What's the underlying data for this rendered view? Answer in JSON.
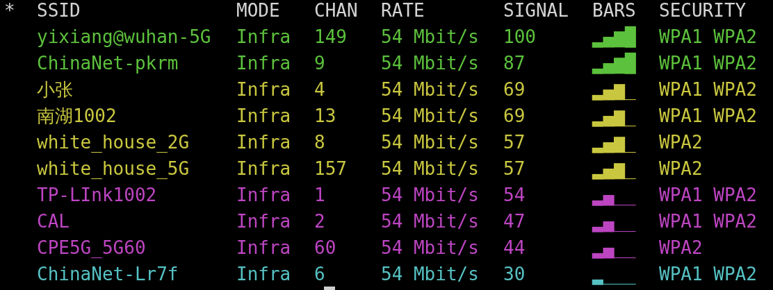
{
  "header": [
    "*",
    "SSID",
    "MODE",
    "CHAN",
    "RATE",
    "SIGNAL",
    "BARS",
    "SECURITY"
  ],
  "rows": [
    {
      "ssid": "yixiang@wuhan-5G",
      "mode": "Infra",
      "chan": "149",
      "rate": "54 Mbit/s",
      "signal": "100",
      "bars": "▂▄▆█",
      "security": "WPA1 WPA2",
      "color": "#5cc13c"
    },
    {
      "ssid": "ChinaNet-pkrm",
      "mode": "Infra",
      "chan": "9",
      "rate": "54 Mbit/s",
      "signal": "87",
      "bars": "▂▄▆█",
      "security": "WPA1 WPA2",
      "color": "#5cc13c"
    },
    {
      "ssid": "小张",
      "mode": "Infra",
      "chan": "4",
      "rate": "54 Mbit/s",
      "signal": "69",
      "bars": "▂▄▆_",
      "security": "WPA1 WPA2",
      "color": "#c9c73f"
    },
    {
      "ssid": "南湖1002",
      "mode": "Infra",
      "chan": "13",
      "rate": "54 Mbit/s",
      "signal": "69",
      "bars": "▂▄▆_",
      "security": "WPA1 WPA2",
      "color": "#c9c73f"
    },
    {
      "ssid": "white_house_2G",
      "mode": "Infra",
      "chan": "8",
      "rate": "54 Mbit/s",
      "signal": "57",
      "bars": "▂▄▆_",
      "security": "WPA2",
      "color": "#c9c73f"
    },
    {
      "ssid": "white_house_5G",
      "mode": "Infra",
      "chan": "157",
      "rate": "54 Mbit/s",
      "signal": "57",
      "bars": "▂▄▆_",
      "security": "WPA2",
      "color": "#c9c73f"
    },
    {
      "ssid": "TP-LInk1002",
      "mode": "Infra",
      "chan": "1",
      "rate": "54 Mbit/s",
      "signal": "54",
      "bars": "▂▄__",
      "security": "WPA1 WPA2",
      "color": "#bd45c2"
    },
    {
      "ssid": "CAL",
      "mode": "Infra",
      "chan": "2",
      "rate": "54 Mbit/s",
      "signal": "47",
      "bars": "▂▄__",
      "security": "WPA1 WPA2",
      "color": "#bd45c2"
    },
    {
      "ssid": "CPE5G_5G60",
      "mode": "Infra",
      "chan": "60",
      "rate": "54 Mbit/s",
      "signal": "44",
      "bars": "▂▄__",
      "security": "WPA2",
      "color": "#bd45c2"
    },
    {
      "ssid": "ChinaNet-Lr7f",
      "mode": "Infra",
      "chan": "6",
      "rate": "54 Mbit/s",
      "signal": "30",
      "bars": "▂___",
      "security": "WPA1 WPA2",
      "color": "#56c1c3"
    }
  ]
}
